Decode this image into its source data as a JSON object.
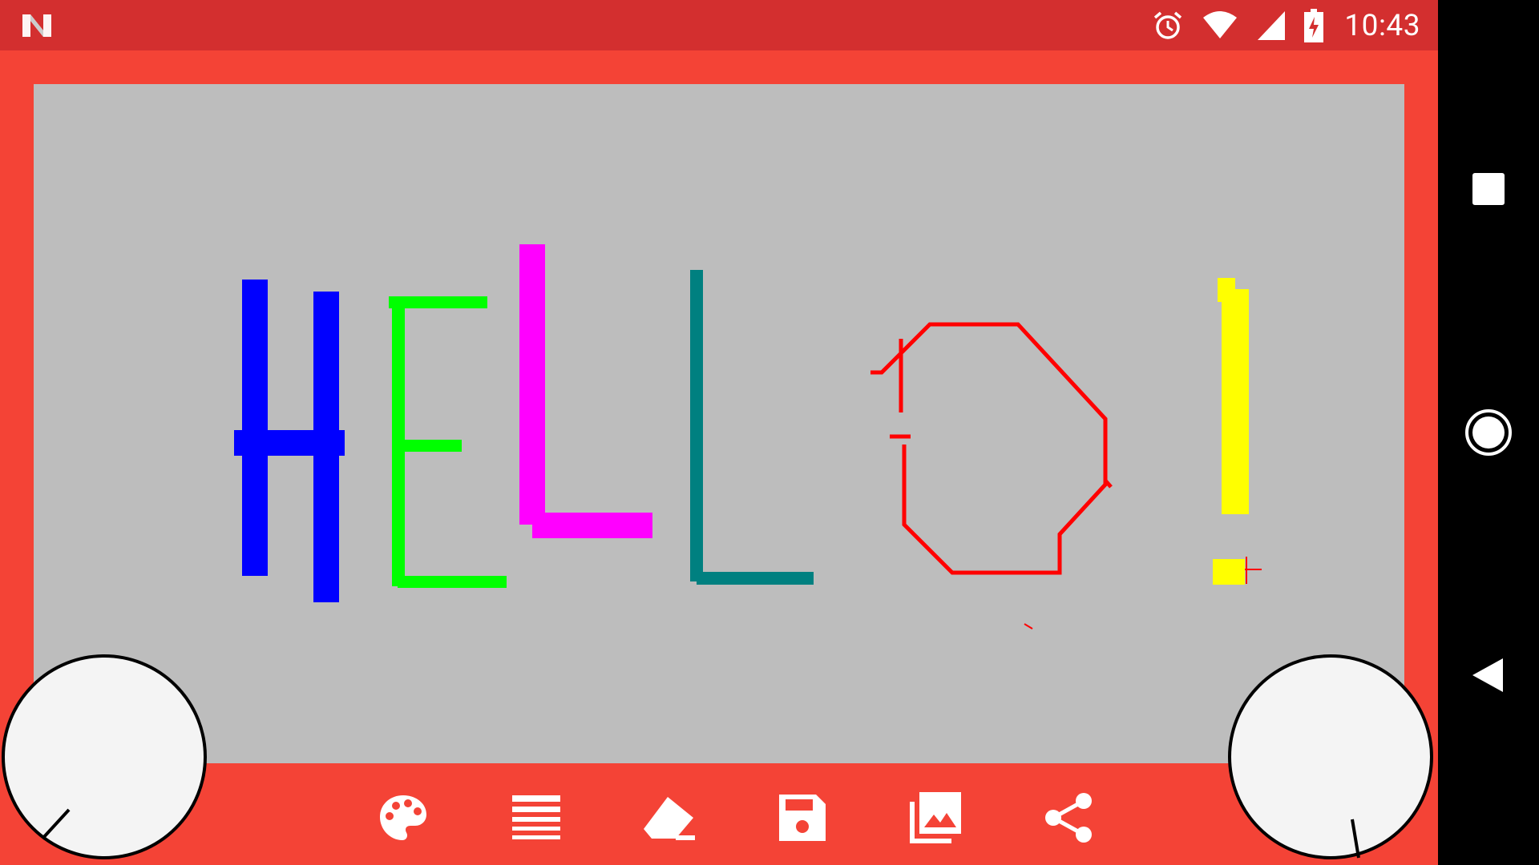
{
  "status_bar": {
    "time": "10:43",
    "icons": [
      "n-logo-icon",
      "alarm-icon",
      "wifi-icon",
      "signal-icon",
      "battery-charging-icon"
    ],
    "color": "#d32f2f"
  },
  "app": {
    "frame_color": "#f44336",
    "canvas_color": "#bdbdbd",
    "drawing_colors": [
      "#0000ff",
      "#00ff00",
      "#ff00ff",
      "#008080",
      "#ff0000",
      "#ffff00"
    ]
  },
  "toolbar": {
    "tools": [
      {
        "icon": "palette-icon",
        "action": "color"
      },
      {
        "icon": "line-weight-icon",
        "action": "stroke"
      },
      {
        "icon": "eraser-icon",
        "action": "erase"
      },
      {
        "icon": "save-icon",
        "action": "save"
      },
      {
        "icon": "gallery-icon",
        "action": "gallery"
      },
      {
        "icon": "share-icon",
        "action": "share"
      }
    ]
  },
  "knobs": {
    "left": {
      "icon": "left-knob"
    },
    "right": {
      "icon": "right-knob"
    }
  },
  "nav_bar": {
    "buttons": [
      "recents-icon",
      "home-icon",
      "back-icon"
    ]
  }
}
